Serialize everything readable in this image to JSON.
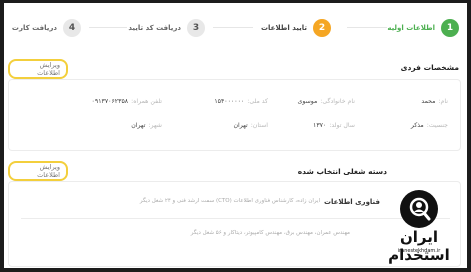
{
  "stepper": {
    "steps": [
      {
        "num": "1",
        "label": "اطلاعات اولیه"
      },
      {
        "num": "2",
        "label": "تایید اطلاعات"
      },
      {
        "num": "3",
        "label": "دریافت کد تایید"
      },
      {
        "num": "4",
        "label": "دریافت کارت"
      }
    ]
  },
  "personal": {
    "title": "مشخصات فردی",
    "edit_label": "ویرایش اطلاعات",
    "fields": {
      "name": {
        "label": "نام:",
        "value": "محمد"
      },
      "surname": {
        "label": "نام خانوادگی:",
        "value": "موسوی"
      },
      "national_code": {
        "label": "کد ملی:",
        "value": "۱۵۴۰۰۰۰۰۰"
      },
      "mobile": {
        "label": "تلفن همراه:",
        "value": "۰۹۱۳۷۰۶۲۳۵۸"
      },
      "gender": {
        "label": "جنسیت:",
        "value": "مذکر"
      },
      "birth_year": {
        "label": "سال تولد:",
        "value": "۱۳۷۰"
      },
      "province": {
        "label": "استان:",
        "value": "تهران"
      },
      "city": {
        "label": "شهر:",
        "value": "تهران"
      }
    }
  },
  "jobs": {
    "title": "دسته شغلی انتخاب شده",
    "edit_label": "ویرایش اطلاعات",
    "item1_title": "فناوری اطلاعات",
    "item1_detail": "ایران زاده، کارشناس فناوری اطلاعات (CTO) سمت ارشد فنی و ۲۴ شغل دیگر",
    "item2_detail": "مهندس عمران، مهندس برق، مهندس کامپیوتر، دیتاکار و ۵۶ شغل دیگر"
  },
  "watermark": {
    "text": "ایران استخدام",
    "sub": "iranestekhdam.ir"
  }
}
